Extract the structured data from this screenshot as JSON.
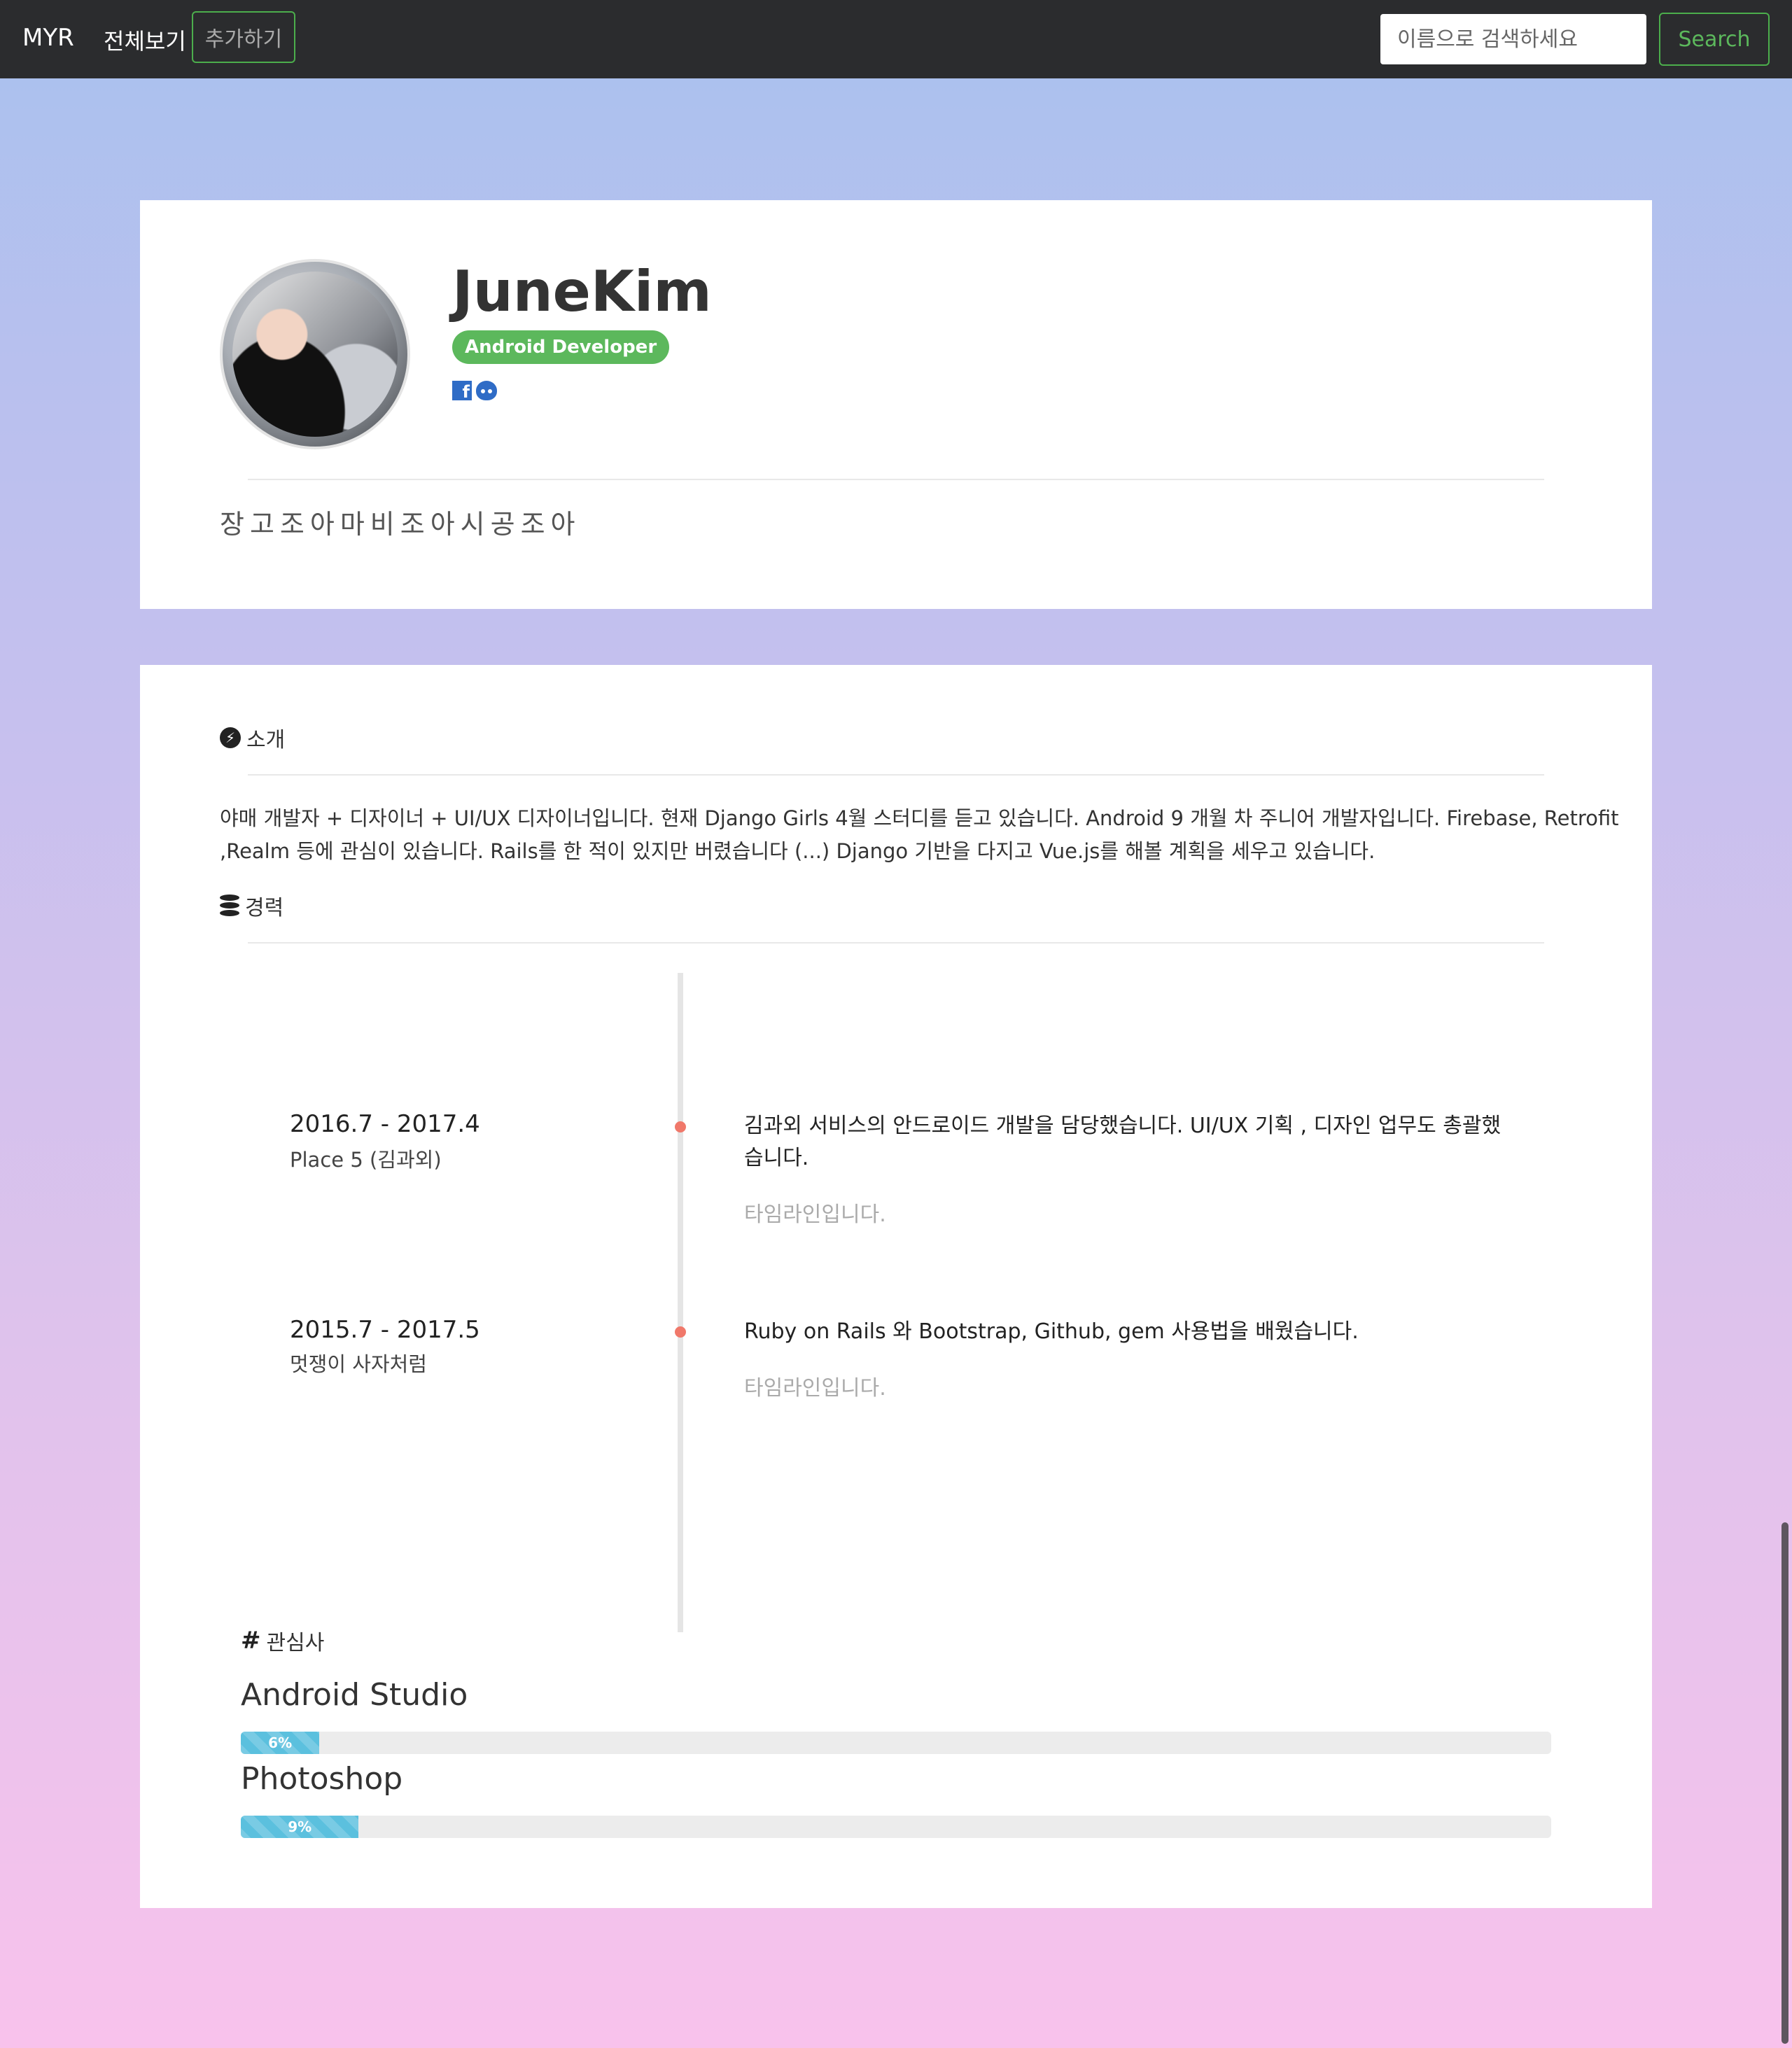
{
  "navbar": {
    "brand": "MYR",
    "view_all": "전체보기",
    "add": "추가하기",
    "search_placeholder": "이름으로 검색하세요",
    "search_button": "Search"
  },
  "profile": {
    "name": "JuneKim",
    "role": "Android Developer",
    "social_icons": [
      "facebook-icon",
      "github-icon"
    ],
    "motto": "장고조아마비조아시공조아"
  },
  "intro": {
    "heading": "소개",
    "icon": "running-icon",
    "text": "야매 개발자 + 디자이너 + UI/UX 디자이너입니다. 현재 Django Girls 4월 스터디를 듣고 있습니다. Android 9 개월 차 주니어 개발자입니다. Firebase, Retrofit ,Realm 등에 관심이 있습니다. Rails를 한 적이 있지만 버렸습니다 (...) Django 기반을 다지고 Vue.js를 해볼 계획을 세우고 있습니다."
  },
  "career": {
    "heading": "경력",
    "icon": "database-icon",
    "items": [
      {
        "date": "2016.7 - 2017.4",
        "place": "Place 5 (김과외)",
        "description": "김과외 서비스의 안드로이드 개발을 담당했습니다. UI/UX 기획 , 디자인 업무도 총괄했습니다.",
        "sub": "타임라인입니다."
      },
      {
        "date": "2015.7 - 2017.5",
        "place": "멋쟁이 사자처럼",
        "description": "Ruby on Rails 와 Bootstrap, Github, gem 사용법을 배웠습니다.",
        "sub": "타임라인입니다."
      }
    ]
  },
  "interests": {
    "heading": "관심사",
    "icon": "hashtag-icon",
    "items": [
      {
        "name": "Android Studio",
        "percent": 6,
        "label": "6%"
      },
      {
        "name": "Photoshop",
        "percent": 9,
        "label": "9%"
      }
    ]
  },
  "colors": {
    "navbar": "#2b2c2e",
    "accent_green": "#5cb85c",
    "progress": "#5bc0de",
    "timeline_dot": "#f0786a"
  }
}
